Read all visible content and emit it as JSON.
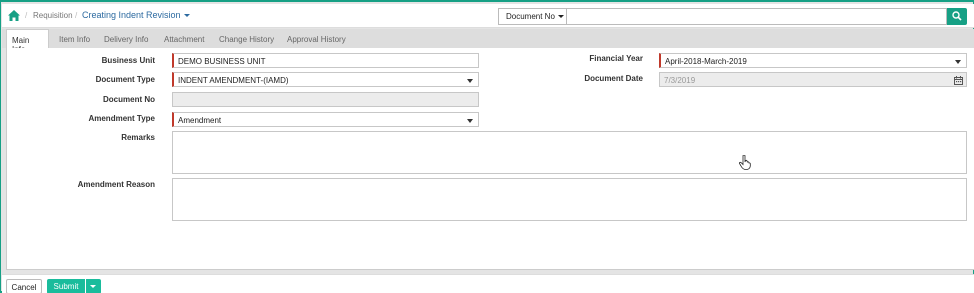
{
  "header": {
    "breadcrumb": [
      "Requisition"
    ],
    "active_page": "Creating Indent Revision",
    "search_type": "Document No",
    "search_value": ""
  },
  "tabs": [
    "Main Info",
    "Item Info",
    "Delivery Info",
    "Attachment",
    "Change History",
    "Approval History"
  ],
  "form": {
    "business_unit_label": "Business Unit",
    "business_unit_value": "DEMO BUSINESS UNIT",
    "document_type_label": "Document Type",
    "document_type_value": "INDENT AMENDMENT-(IAMD)",
    "document_no_label": "Document No",
    "document_no_value": "",
    "amendment_type_label": "Amendment Type",
    "amendment_type_value": "Amendment",
    "remarks_label": "Remarks",
    "amendment_reason_label": "Amendment Reason",
    "financial_year_label": "Financial Year",
    "financial_year_value": "April-2018-March-2019",
    "document_date_label": "Document Date",
    "document_date_value": "7/3/2019"
  },
  "footer": {
    "cancel_label": "Cancel",
    "submit_label": "Submit"
  },
  "colors": {
    "accent": "#16a085",
    "required": "#c0392b"
  },
  "icons": [
    "home-icon",
    "search-icon",
    "calendar-icon",
    "hand-cursor-icon",
    "chevron-down-icon"
  ]
}
